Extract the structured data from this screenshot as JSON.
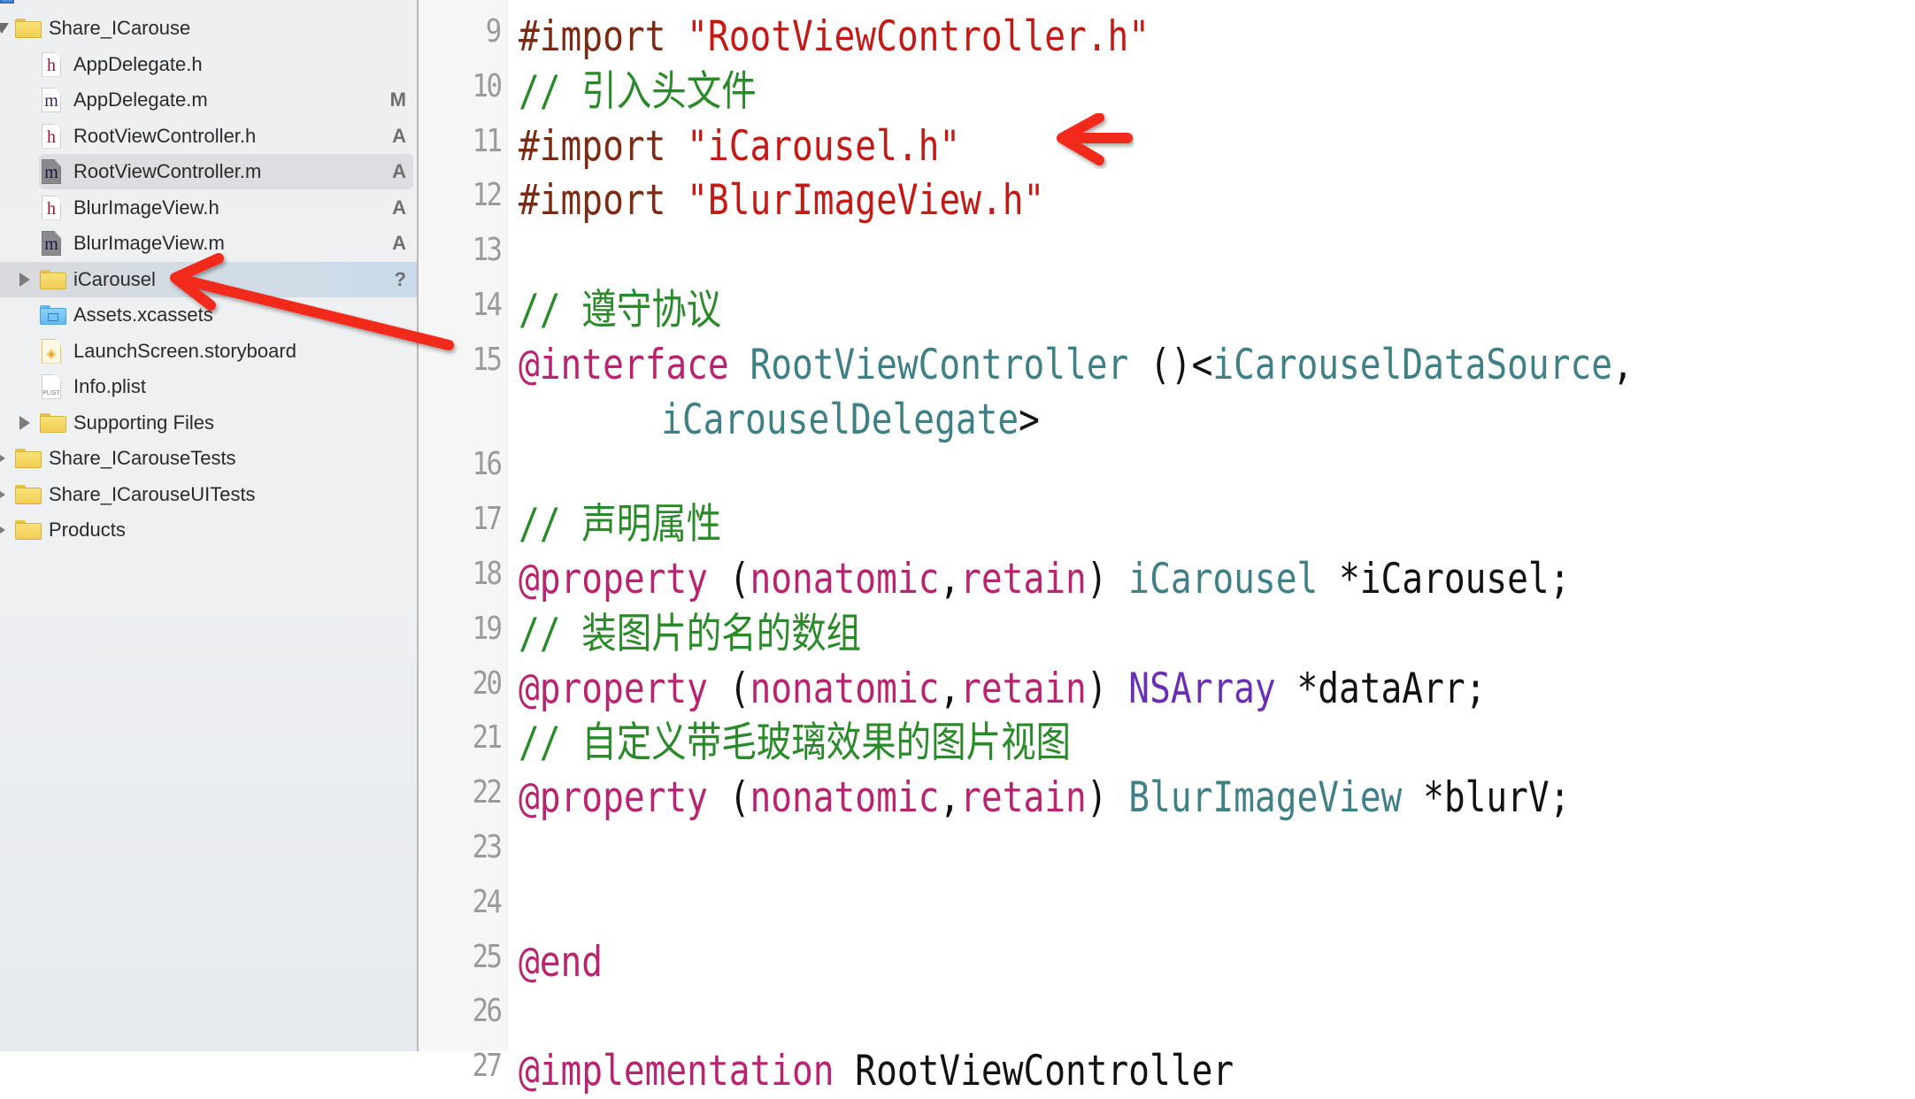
{
  "navigator": {
    "project_row_partial": "Share_ICarouse",
    "items": [
      {
        "label": "Share_ICarouse",
        "kind": "folder",
        "expanded": true,
        "badge": ""
      },
      {
        "label": "AppDelegate.h",
        "kind": "h",
        "badge": ""
      },
      {
        "label": "AppDelegate.m",
        "kind": "m",
        "badge": "M"
      },
      {
        "label": "RootViewController.h",
        "kind": "h",
        "badge": "A"
      },
      {
        "label": "RootViewController.m",
        "kind": "m",
        "badge": "A",
        "selected": true
      },
      {
        "label": "BlurImageView.h",
        "kind": "h",
        "badge": "A"
      },
      {
        "label": "BlurImageView.m",
        "kind": "m",
        "badge": "A"
      },
      {
        "label": "iCarousel",
        "kind": "folder",
        "expanded": false,
        "badge": "?",
        "highlighted": true
      },
      {
        "label": "Assets.xcassets",
        "kind": "assets",
        "badge": ""
      },
      {
        "label": "LaunchScreen.storyboard",
        "kind": "storyboard",
        "badge": ""
      },
      {
        "label": "Info.plist",
        "kind": "plist",
        "badge": ""
      },
      {
        "label": "Supporting Files",
        "kind": "folder",
        "expanded": false,
        "badge": ""
      },
      {
        "label": "Share_ICarouseTests",
        "kind": "folder",
        "expanded": false,
        "badge": ""
      },
      {
        "label": "Share_ICarouseUITests",
        "kind": "folder",
        "expanded": false,
        "badge": ""
      },
      {
        "label": "Products",
        "kind": "folder",
        "expanded": false,
        "badge": ""
      }
    ],
    "icon_glyphs": {
      "h": "h",
      "m": "m",
      "storyboard": "◈",
      "plist": "PLIST"
    }
  },
  "editor": {
    "line_numbers": [
      "9",
      "10",
      "11",
      "12",
      "13",
      "14",
      "15",
      "",
      "16",
      "17",
      "18",
      "19",
      "20",
      "21",
      "22",
      "23",
      "24",
      "25",
      "26",
      "27"
    ],
    "lines": [
      {
        "n": "9",
        "tokens": [
          [
            "pre",
            "#import "
          ],
          [
            "str",
            "\"RootViewController.h\""
          ]
        ]
      },
      {
        "n": "10",
        "tokens": [
          [
            "com",
            "// "
          ],
          [
            "com cjk",
            "引入头文件"
          ]
        ]
      },
      {
        "n": "11",
        "tokens": [
          [
            "pre",
            "#import "
          ],
          [
            "str",
            "\"iCarousel.h\""
          ]
        ]
      },
      {
        "n": "12",
        "tokens": [
          [
            "pre",
            "#import "
          ],
          [
            "str",
            "\"BlurImageView.h\""
          ]
        ]
      },
      {
        "n": "13",
        "tokens": []
      },
      {
        "n": "14",
        "tokens": [
          [
            "com",
            "// "
          ],
          [
            "com cjk",
            "遵守协议"
          ]
        ]
      },
      {
        "n": "15",
        "tokens": [
          [
            "kw",
            "@interface"
          ],
          [
            "pl",
            " "
          ],
          [
            "cls",
            "RootViewController"
          ],
          [
            "pl",
            " ()<"
          ],
          [
            "cls",
            "iCarouselDataSource"
          ],
          [
            "pl",
            ","
          ]
        ]
      },
      {
        "n": "",
        "tokens": [
          [
            "pl",
            "    "
          ],
          [
            "cls",
            "iCarouselDelegate"
          ],
          [
            "pl",
            ">"
          ]
        ]
      },
      {
        "n": "16",
        "tokens": []
      },
      {
        "n": "17",
        "tokens": [
          [
            "com",
            "// "
          ],
          [
            "com cjk",
            "声明属性"
          ]
        ]
      },
      {
        "n": "18",
        "tokens": [
          [
            "kw",
            "@property"
          ],
          [
            "pl",
            " ("
          ],
          [
            "kw",
            "nonatomic"
          ],
          [
            "pl",
            ","
          ],
          [
            "kw",
            "retain"
          ],
          [
            "pl",
            ") "
          ],
          [
            "cls",
            "iCarousel"
          ],
          [
            "pl",
            " *iCarousel;"
          ]
        ]
      },
      {
        "n": "19",
        "tokens": [
          [
            "com",
            "// "
          ],
          [
            "com cjk",
            "装图片的名的数组"
          ]
        ]
      },
      {
        "n": "20",
        "tokens": [
          [
            "kw",
            "@property"
          ],
          [
            "pl",
            " ("
          ],
          [
            "kw",
            "nonatomic"
          ],
          [
            "pl",
            ","
          ],
          [
            "kw",
            "retain"
          ],
          [
            "pl",
            ") "
          ],
          [
            "sys",
            "NSArray"
          ],
          [
            "pl",
            " *dataArr;"
          ]
        ]
      },
      {
        "n": "21",
        "tokens": [
          [
            "com",
            "// "
          ],
          [
            "com cjk",
            "自定义带毛玻璃效果的图片视图"
          ]
        ]
      },
      {
        "n": "22",
        "tokens": [
          [
            "kw",
            "@property"
          ],
          [
            "pl",
            " ("
          ],
          [
            "kw",
            "nonatomic"
          ],
          [
            "pl",
            ","
          ],
          [
            "kw",
            "retain"
          ],
          [
            "pl",
            ") "
          ],
          [
            "cls",
            "BlurImageView"
          ],
          [
            "pl",
            " *blurV;"
          ]
        ]
      },
      {
        "n": "23",
        "tokens": []
      },
      {
        "n": "24",
        "tokens": []
      },
      {
        "n": "25",
        "tokens": [
          [
            "kw",
            "@end"
          ]
        ]
      },
      {
        "n": "26",
        "tokens": []
      },
      {
        "n": "27",
        "tokens": [
          [
            "kw",
            "@implementation"
          ],
          [
            "pl",
            " RootViewController"
          ]
        ]
      }
    ]
  },
  "annotations": {
    "arrow_color": "#f2291c",
    "arrows": [
      {
        "name": "arrow-to-icarousel-folder",
        "points_to": "iCarousel"
      },
      {
        "name": "arrow-to-icarousel-import",
        "points_to": "#import \"iCarousel.h\""
      }
    ]
  },
  "colors": {
    "preprocessor": "#7b2a14",
    "string": "#c31a16",
    "comment": "#2a8a2a",
    "keyword": "#b8246f",
    "project_type": "#3f7f86",
    "system_type": "#6b2fb3",
    "plain": "#111111",
    "line_number": "#9a9a9a"
  }
}
